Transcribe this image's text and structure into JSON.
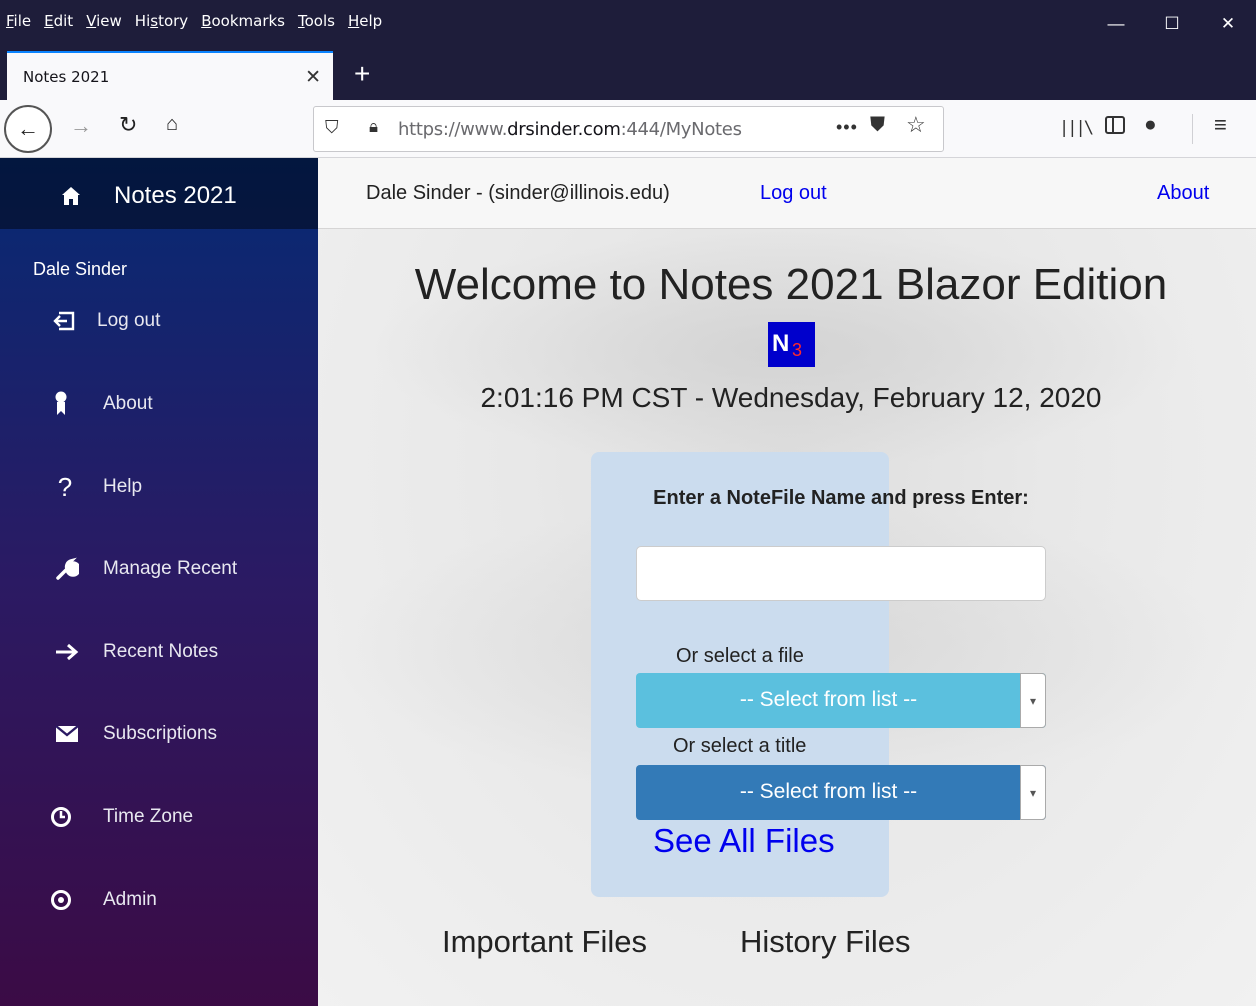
{
  "browser": {
    "menu": [
      "File",
      "Edit",
      "View",
      "History",
      "Bookmarks",
      "Tools",
      "Help"
    ],
    "menu_mnemonics": [
      "F",
      "E",
      "V",
      "s",
      "B",
      "T",
      "H"
    ],
    "window_controls": {
      "minimize": "—",
      "maximize": "☐",
      "close": "✕"
    },
    "tab": {
      "title": "Notes 2021",
      "close": "✕"
    },
    "new_tab": "+",
    "url": {
      "prefix": "https://www.",
      "domain": "drsinder.com",
      "suffix": ":444/MyNotes"
    }
  },
  "sidebar": {
    "brand": "Notes 2021",
    "user": "Dale Sinder",
    "items": [
      {
        "label": "Log out",
        "icon": "sign-out-icon"
      },
      {
        "label": "About",
        "icon": "badge-icon"
      },
      {
        "label": "Help",
        "icon": "question-icon"
      },
      {
        "label": "Manage Recent",
        "icon": "wrench-icon"
      },
      {
        "label": "Recent Notes",
        "icon": "arrow-right-icon"
      },
      {
        "label": "Subscriptions",
        "icon": "envelope-icon"
      },
      {
        "label": "Time Zone",
        "icon": "clock-icon"
      },
      {
        "label": "Admin",
        "icon": "admin-icon"
      }
    ]
  },
  "topbar": {
    "user_line": "Dale Sinder - (sinder@illinois.edu)",
    "logout": "Log out",
    "about": "About"
  },
  "main": {
    "welcome": "Welcome to Notes 2021 Blazor Edition",
    "logo": {
      "n": "N",
      "num": "3"
    },
    "clock": "2:01:16 PM CST - Wednesday, February 12, 2020",
    "prompt": "Enter a NoteFile Name and press Enter:",
    "notefile_value": "",
    "or_file": "Or select a file",
    "file_select": "-- Select from list --",
    "or_title": "Or select a title",
    "title_select": "-- Select from list --",
    "see_all": "See All Files",
    "important": "Important Files",
    "history": "History Files"
  },
  "colors": {
    "file_select_bg": "#5bc0de",
    "title_select_bg": "#337ab7",
    "panel_bg": "#cbdcee",
    "link": "#0000ee"
  }
}
